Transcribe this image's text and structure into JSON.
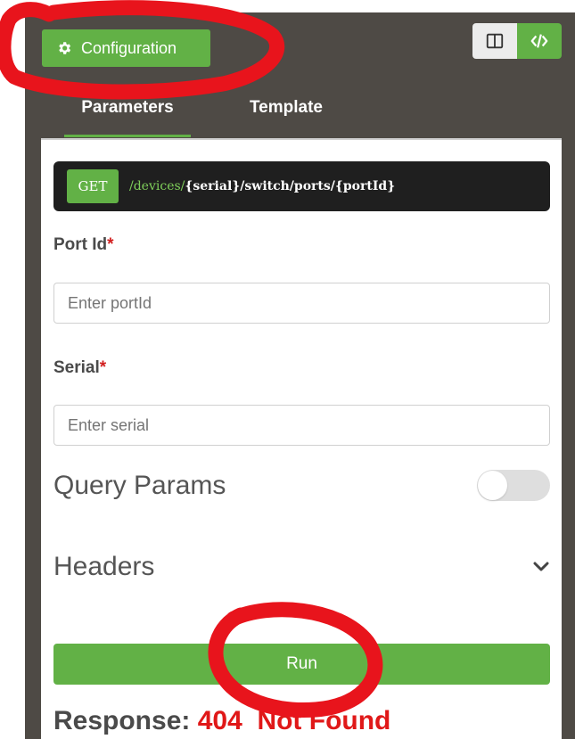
{
  "header": {
    "config_label": "Configuration",
    "icons": {
      "config": "gear-icon",
      "split_view": "split-view-icon",
      "code_view": "code-icon"
    }
  },
  "tabs": [
    {
      "label": "Parameters",
      "active": true
    },
    {
      "label": "Template",
      "active": false
    }
  ],
  "endpoint": {
    "method": "GET",
    "path_static": "/devices/",
    "path_params": "{serial}/switch/ports/{portId}"
  },
  "fields": {
    "port_id": {
      "label": "Port Id",
      "required_mark": "*",
      "placeholder": "Enter portId",
      "value": ""
    },
    "serial": {
      "label": "Serial",
      "required_mark": "*",
      "placeholder": "Enter serial",
      "value": ""
    }
  },
  "query_params": {
    "label": "Query Params",
    "enabled": false
  },
  "headers_section": {
    "label": "Headers",
    "icon": "chevron-down-icon"
  },
  "run_label": "Run",
  "response": {
    "label": "Response:",
    "status": "404  Not Found"
  },
  "colors": {
    "accent": "#62b146",
    "panel_bg": "#4e4a45",
    "endpoint_bg": "#1f1f1f",
    "error": "#e01818",
    "required": "#d21f1f",
    "annotation": "#e8141c"
  }
}
